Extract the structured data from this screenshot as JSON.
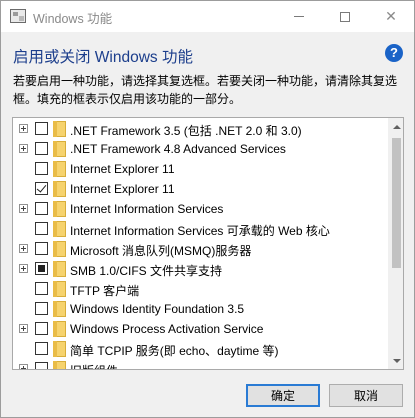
{
  "window": {
    "title": "Windows 功能",
    "heading": "启用或关闭 Windows 功能",
    "description": "若要启用一种功能，请选择其复选框。若要关闭一种功能，请清除其复选框。填充的框表示仅启用该功能的一部分。"
  },
  "features": [
    {
      "label": ".NET Framework 3.5 (包括 .NET 2.0 和 3.0)",
      "expandable": true,
      "state": "unchecked"
    },
    {
      "label": ".NET Framework 4.8 Advanced Services",
      "expandable": true,
      "state": "unchecked"
    },
    {
      "label": "Internet Explorer 11",
      "expandable": false,
      "state": "unchecked"
    },
    {
      "label": "Internet Explorer 11",
      "expandable": false,
      "state": "checked"
    },
    {
      "label": "Internet Information Services",
      "expandable": true,
      "state": "unchecked"
    },
    {
      "label": "Internet Information Services 可承载的 Web 核心",
      "expandable": false,
      "state": "unchecked"
    },
    {
      "label": "Microsoft 消息队列(MSMQ)服务器",
      "expandable": true,
      "state": "unchecked"
    },
    {
      "label": "SMB 1.0/CIFS 文件共享支持",
      "expandable": true,
      "state": "partial"
    },
    {
      "label": "TFTP 客户端",
      "expandable": false,
      "state": "unchecked"
    },
    {
      "label": "Windows Identity Foundation 3.5",
      "expandable": false,
      "state": "unchecked"
    },
    {
      "label": "Windows Process Activation Service",
      "expandable": true,
      "state": "unchecked"
    },
    {
      "label": "简单 TCPIP 服务(即 echo、daytime 等)",
      "expandable": false,
      "state": "unchecked"
    },
    {
      "label": "旧版组件",
      "expandable": true,
      "state": "unchecked"
    }
  ],
  "buttons": {
    "ok": "确定",
    "cancel": "取消"
  },
  "icons": {
    "title": "windows-features-icon",
    "help": "help-icon"
  },
  "colors": {
    "heading": "#1c3e8c",
    "help": "#1a63c7",
    "folder": "#f6d36e"
  }
}
